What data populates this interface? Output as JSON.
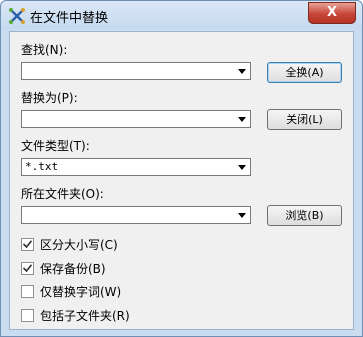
{
  "window": {
    "title": "在文件中替换",
    "close_glyph": "X"
  },
  "find": {
    "label": "查找(N):",
    "value": ""
  },
  "replace": {
    "label": "替换为(P):",
    "value": ""
  },
  "filetype": {
    "label": "文件类型(T):",
    "value": "*.txt"
  },
  "folder": {
    "label": "所在文件夹(O):",
    "value": ""
  },
  "buttons": {
    "replace_all": "全换(A)",
    "close": "关闭(L)",
    "browse": "浏览(B)"
  },
  "options": [
    {
      "label": "区分大小写(C)",
      "checked": true
    },
    {
      "label": "保存备份(B)",
      "checked": true
    },
    {
      "label": "仅替换字词(W)",
      "checked": false
    },
    {
      "label": "包括子文件夹(R)",
      "checked": false
    }
  ],
  "colors": {
    "titlebar": "#c5d9ef",
    "close": "#c7453a",
    "client": "#f0f0f0"
  }
}
